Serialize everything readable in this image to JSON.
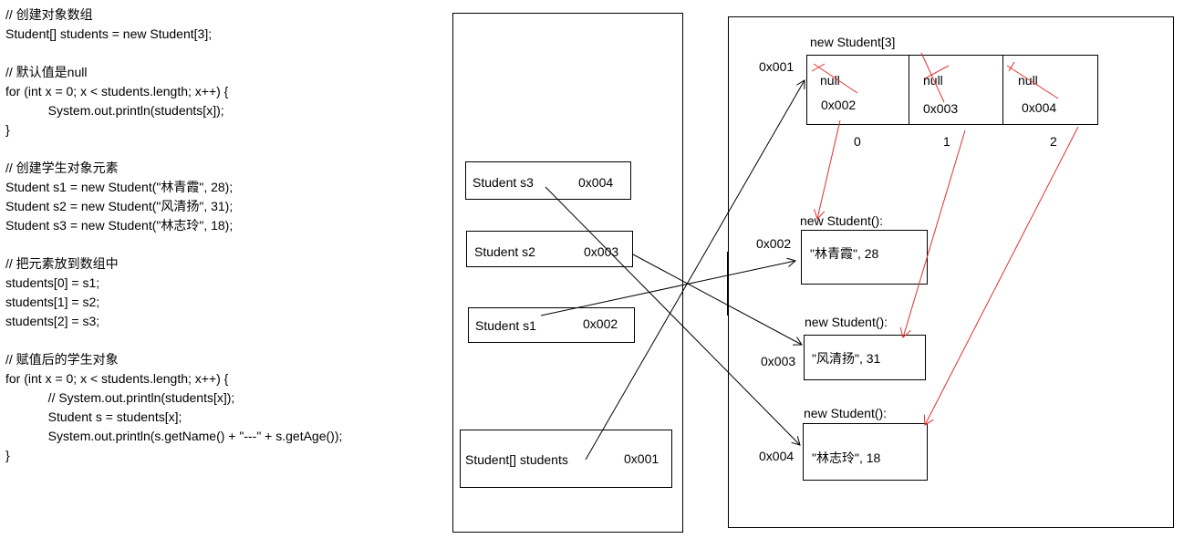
{
  "code_lines": [
    "// 创建对象数组",
    "Student[] students = new Student[3];",
    "",
    "// 默认值是null",
    "for (int x = 0; x < students.length; x++) {",
    "            System.out.println(students[x]);",
    "}",
    "",
    "// 创建学生对象元素",
    "Student s1 = new Student(\"林青霞\", 28);",
    "Student s2 = new Student(\"风清扬\", 31);",
    "Student s3 = new Student(\"林志玲\", 18);",
    "",
    "// 把元素放到数组中",
    "students[0] = s1;",
    "students[1] = s2;",
    "students[2] = s3;",
    "",
    "// 赋值后的学生对象",
    "for (int x = 0; x < students.length; x++) {",
    "            // System.out.println(students[x]);",
    "            Student s = students[x];",
    "            System.out.println(s.getName() + \"---\" + s.getAge());",
    "}"
  ],
  "stack": {
    "vars": [
      {
        "name": "Student s3",
        "addr": "0x004"
      },
      {
        "name": "Student s2",
        "addr": "0x003"
      },
      {
        "name": "Student s1",
        "addr": "0x002"
      },
      {
        "name": "Student[] students",
        "addr": "0x001"
      }
    ]
  },
  "heap": {
    "array": {
      "title": "new Student[3]",
      "addr": "0x001",
      "cells": [
        {
          "old": "null",
          "value": "0x002",
          "index": "0"
        },
        {
          "old": "null",
          "value": "0x003",
          "index": "1"
        },
        {
          "old": "null",
          "value": "0x004",
          "index": "2"
        }
      ]
    },
    "objects": [
      {
        "title": "new Student():",
        "addr": "0x002",
        "content": "\"林青霞\", 28"
      },
      {
        "title": "new Student():",
        "addr": "0x003",
        "content": "\"风清扬\", 31"
      },
      {
        "title": "new Student():",
        "addr": "0x004",
        "content": "\"林志玲\", 18"
      }
    ]
  },
  "colors": {
    "line": "#000000",
    "pointer": "#e03030"
  }
}
